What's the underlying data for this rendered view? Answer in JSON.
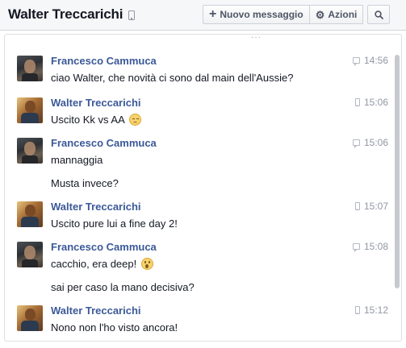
{
  "header": {
    "title": "Walter Treccarichi",
    "title_device_icon": "mobile-icon",
    "buttons": {
      "new_message_label": "Nuovo messaggio",
      "new_message_icon": "plus-icon",
      "actions_label": "Azioni",
      "actions_icon": "gear-icon",
      "search_icon": "search-icon"
    }
  },
  "conversation": {
    "groups": [
      {
        "sender": "Francesco Cammuca",
        "avatar": "avatar-francesco",
        "time": "14:56",
        "source_icon": "chat-icon",
        "messages": [
          "ciao Walter, che novità ci sono dal main dell'Aussie?"
        ]
      },
      {
        "sender": "Walter Treccarichi",
        "avatar": "avatar-walter",
        "time": "15:06",
        "source_icon": "mobile-icon",
        "messages": [
          "Uscito Kk vs AA"
        ],
        "emoji": "pensive-face"
      },
      {
        "sender": "Francesco Cammuca",
        "avatar": "avatar-francesco",
        "time": "15:06",
        "source_icon": "chat-icon",
        "messages": [
          "mannaggia",
          "Musta invece?"
        ]
      },
      {
        "sender": "Walter Treccarichi",
        "avatar": "avatar-walter",
        "time": "15:07",
        "source_icon": "mobile-icon",
        "messages": [
          "Uscito pure lui a fine day 2!"
        ]
      },
      {
        "sender": "Francesco Cammuca",
        "avatar": "avatar-francesco",
        "time": "15:08",
        "source_icon": "chat-icon",
        "messages": [
          "cacchio, era deep!",
          "sai per caso la mano decisiva?"
        ],
        "emoji": "gasp-face"
      },
      {
        "sender": "Walter Treccarichi",
        "avatar": "avatar-walter",
        "time": "15:12",
        "source_icon": "mobile-icon",
        "messages": [
          "Nono non l'ho visto ancora!"
        ]
      }
    ]
  },
  "colors": {
    "sender_name": "#3b5998",
    "timestamp": "#9197a3",
    "header_bg": "#f6f7f8"
  }
}
